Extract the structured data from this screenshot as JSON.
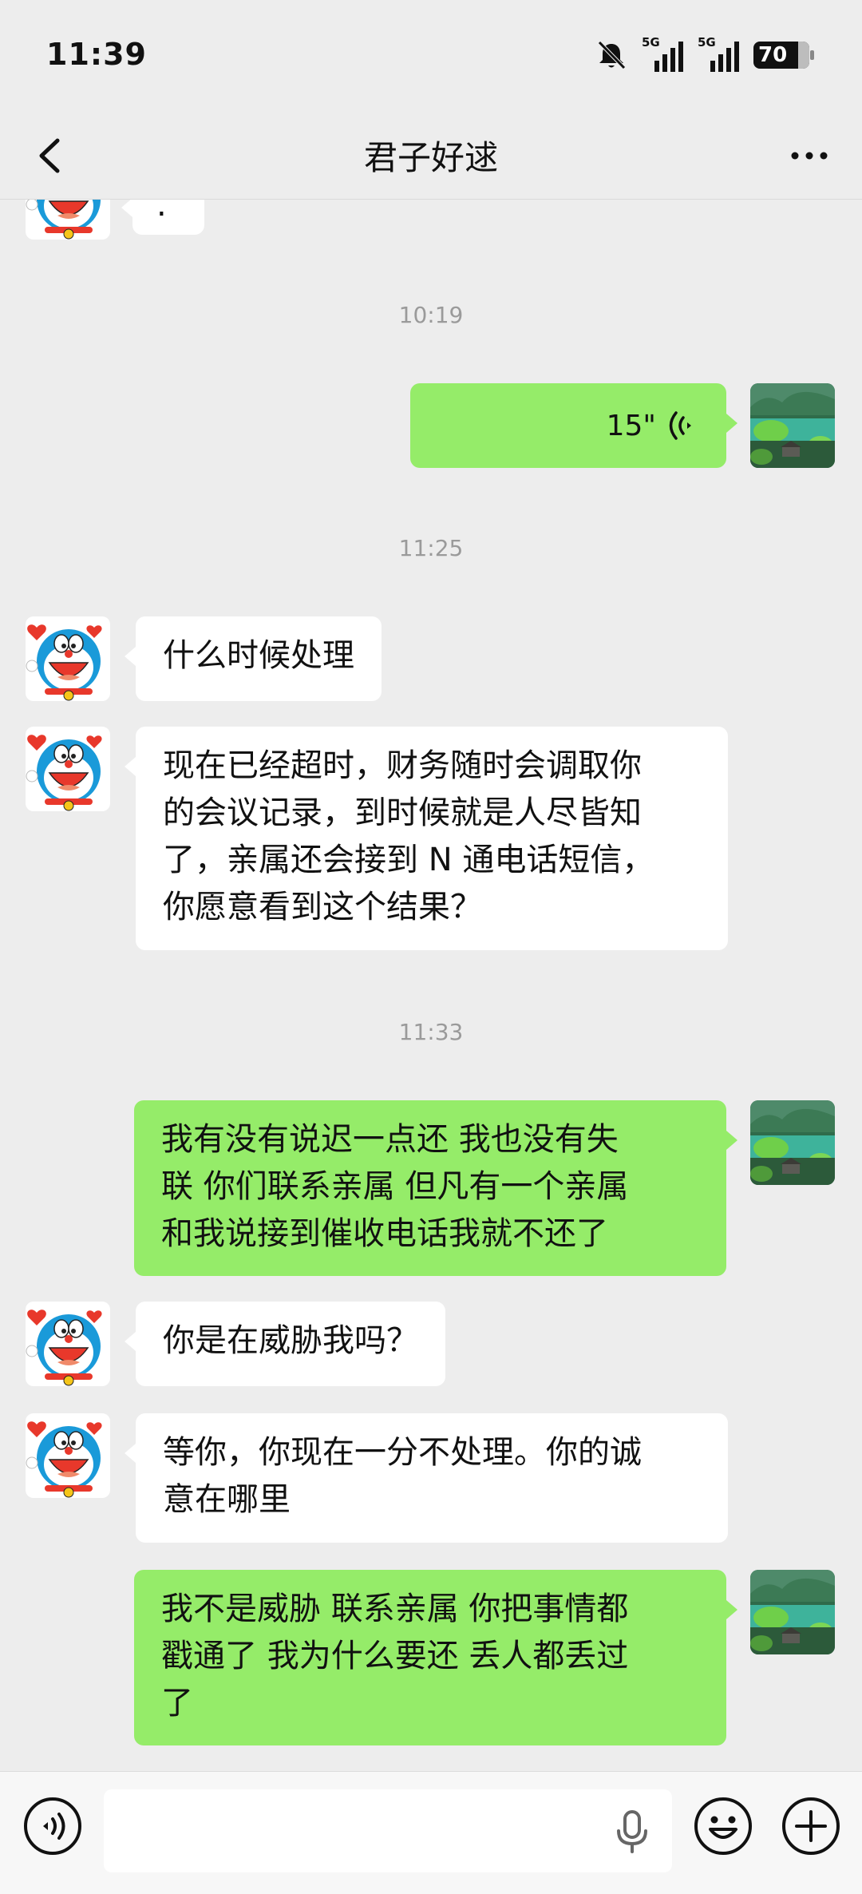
{
  "status_bar": {
    "time": "11:39",
    "network_1": "5G",
    "network_2": "5G",
    "battery": "70"
  },
  "header": {
    "title": "君子好逑"
  },
  "messages": {
    "partial_top": {
      "text": "."
    },
    "ts1": "10:19",
    "voice": {
      "duration": "15\""
    },
    "ts2": "11:25",
    "m1": {
      "text": "什么时候处理"
    },
    "m2": {
      "lines": [
        "现在已经超时，财务随时会调取你",
        "的会议记录，到时候就是人尽皆知",
        "了，亲属还会接到 N 通电话短信，",
        "你愿意看到这个结果？"
      ]
    },
    "ts3": "11:33",
    "m3": {
      "lines": [
        "我有没有说迟一点还  我也没有失",
        "联  你们联系亲属  但凡有一个亲属",
        "和我说接到催收电话我就不还了"
      ]
    },
    "m4": {
      "text": "你是在威胁我吗？"
    },
    "m5": {
      "lines": [
        "等你，你现在一分不处理。你的诚",
        "意在哪里"
      ]
    },
    "m6": {
      "lines": [
        "我不是威胁  联系亲属  你把事情都",
        "戳通了  我为什么要还  丢人都丢过",
        "了"
      ]
    }
  },
  "input_bar": {
    "placeholder": ""
  },
  "icons": {
    "back": "back-chevron-icon",
    "more": "more-dots-icon",
    "voice_mode": "voice-mode-icon",
    "microphone": "microphone-icon",
    "emoji": "emoji-icon",
    "add": "add-icon",
    "muted": "bell-muted-icon"
  },
  "colors": {
    "background": "#ededed",
    "incoming_bubble": "#ffffff",
    "outgoing_bubble": "#95ec69",
    "timestamp": "#9a9a9a"
  }
}
